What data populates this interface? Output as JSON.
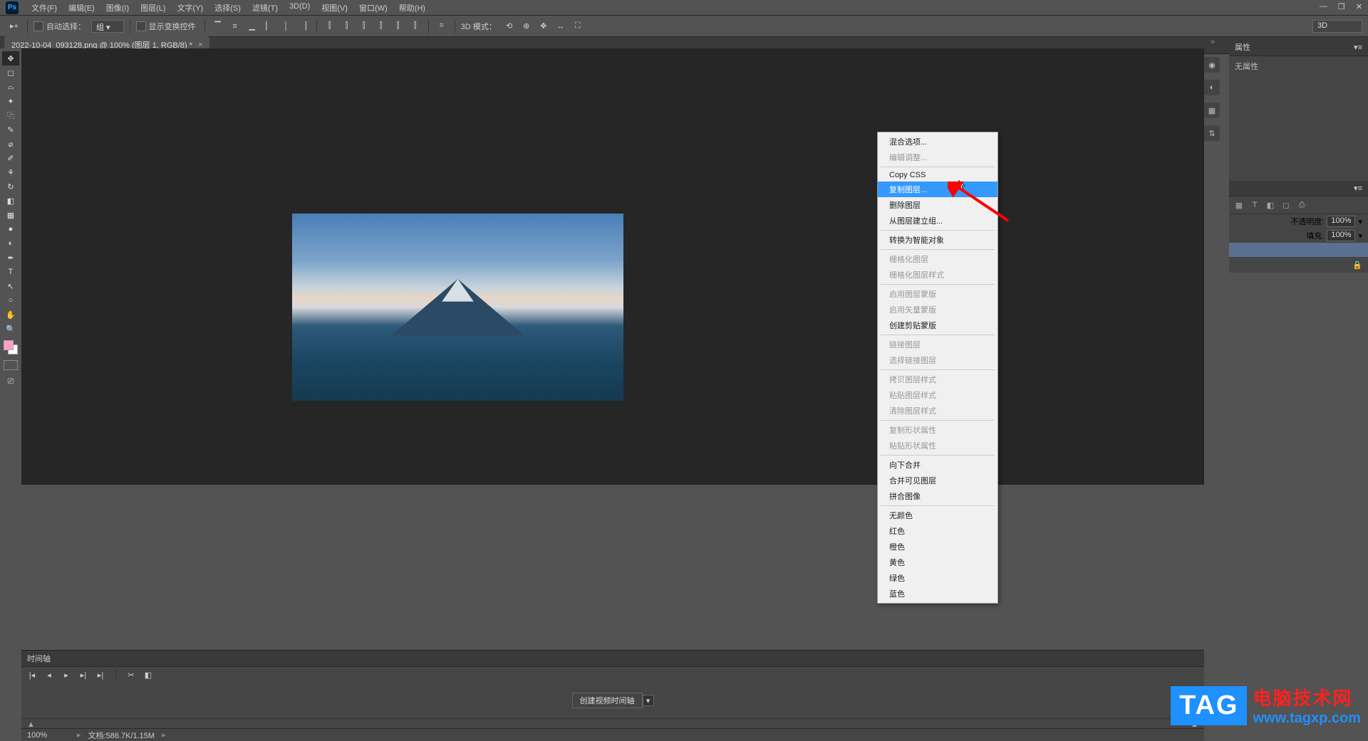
{
  "menu": {
    "items": [
      "文件(F)",
      "编辑(E)",
      "图像(I)",
      "图层(L)",
      "文字(Y)",
      "选择(S)",
      "滤镜(T)",
      "3D(D)",
      "视图(V)",
      "窗口(W)",
      "帮助(H)"
    ]
  },
  "options": {
    "auto_select": "自动选择：",
    "group": "组",
    "show_transform": "显示变换控件",
    "mode_3d": "3D 模式：",
    "right_3d": "3D"
  },
  "doc_tab": {
    "title": "2022-10-04_093128.png @ 100% (图层 1, RGB/8) *"
  },
  "tools": [
    "move",
    "marquee",
    "lasso",
    "wand",
    "crop",
    "eyedropper",
    "heal",
    "brush",
    "stamp",
    "history",
    "eraser",
    "gradient",
    "blur",
    "dodge",
    "pen",
    "text",
    "path",
    "shape",
    "hand",
    "zoom"
  ],
  "right_panels": {
    "properties_title": "属性",
    "properties_text": "无属性",
    "opacity_label": "不透明度:",
    "opacity_value": "100%",
    "fill_label": "填充:",
    "fill_value": "100%"
  },
  "context_menu": {
    "items": [
      {
        "label": "混合选项...",
        "state": "normal"
      },
      {
        "label": "编辑调整...",
        "state": "disabled"
      },
      {
        "type": "sep"
      },
      {
        "label": "Copy CSS",
        "state": "normal"
      },
      {
        "label": "复制图层...",
        "state": "highlight"
      },
      {
        "label": "删除图层",
        "state": "normal"
      },
      {
        "label": "从图层建立组...",
        "state": "normal"
      },
      {
        "type": "sep"
      },
      {
        "label": "转换为智能对象",
        "state": "normal"
      },
      {
        "type": "sep"
      },
      {
        "label": "栅格化图层",
        "state": "disabled"
      },
      {
        "label": "栅格化图层样式",
        "state": "disabled"
      },
      {
        "type": "sep"
      },
      {
        "label": "启用图层蒙版",
        "state": "disabled"
      },
      {
        "label": "启用矢量蒙版",
        "state": "disabled"
      },
      {
        "label": "创建剪贴蒙版",
        "state": "normal"
      },
      {
        "type": "sep"
      },
      {
        "label": "链接图层",
        "state": "disabled"
      },
      {
        "label": "选择链接图层",
        "state": "disabled"
      },
      {
        "type": "sep"
      },
      {
        "label": "拷贝图层样式",
        "state": "disabled"
      },
      {
        "label": "粘贴图层样式",
        "state": "disabled"
      },
      {
        "label": "清除图层样式",
        "state": "disabled"
      },
      {
        "type": "sep"
      },
      {
        "label": "复制形状属性",
        "state": "disabled"
      },
      {
        "label": "粘贴形状属性",
        "state": "disabled"
      },
      {
        "type": "sep"
      },
      {
        "label": "向下合并",
        "state": "normal"
      },
      {
        "label": "合并可见图层",
        "state": "normal"
      },
      {
        "label": "拼合图像",
        "state": "normal"
      },
      {
        "type": "sep"
      },
      {
        "label": "无颜色",
        "state": "normal"
      },
      {
        "label": "红色",
        "state": "normal"
      },
      {
        "label": "橙色",
        "state": "normal"
      },
      {
        "label": "黄色",
        "state": "normal"
      },
      {
        "label": "绿色",
        "state": "normal"
      },
      {
        "label": "蓝色",
        "state": "normal"
      }
    ]
  },
  "timeline": {
    "title": "时间轴",
    "create_btn": "创建视频时间轴"
  },
  "status": {
    "zoom": "100%",
    "info": "文档:586.7K/1.15M"
  },
  "color_fg": "#ff9ec5",
  "watermark": {
    "tag": "TAG",
    "line1": "电脑技术网",
    "line2": "www.tagxp.com"
  }
}
